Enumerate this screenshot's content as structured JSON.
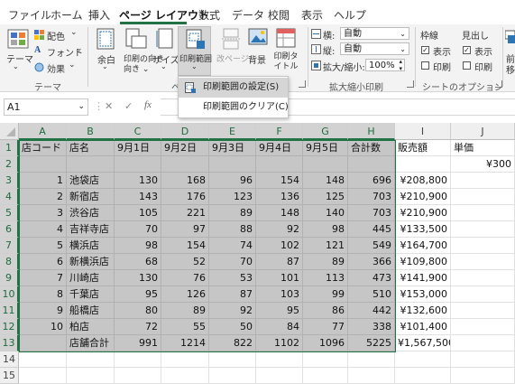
{
  "tabs": [
    "ファイル",
    "ホーム",
    "挿入",
    "ページ レイアウト",
    "数式",
    "データ",
    "校閲",
    "表示",
    "ヘルプ"
  ],
  "ribbon": {
    "theme": {
      "theme_label": "テーマ",
      "colors_label": "配色",
      "fonts_label": "フォント",
      "effects_label": "効果",
      "group_label": "テーマ"
    },
    "page_setup": {
      "margins_label": "余白",
      "orientation_label": "印刷の向き",
      "size_label": "サイズ",
      "print_area_label": "印刷範囲",
      "breaks_label": "改ページ",
      "background_label": "背景",
      "print_titles_label": "印刷タイトル",
      "group_label_partial": "ペ"
    },
    "scale": {
      "width_label": "横:",
      "width_value": "自動",
      "height_label": "縦:",
      "height_value": "自動",
      "scale_label": "拡大/縮小:",
      "scale_value": "100%",
      "group_label": "拡大縮小印刷"
    },
    "sheet_options": {
      "gridlines_label": "枠線",
      "headings_label": "見出し",
      "view_label": "表示",
      "print_label": "印刷",
      "group_label": "シートのオプション"
    },
    "arrange_partial": {
      "line1": "前",
      "line2": "移"
    }
  },
  "menu": {
    "set_print_area": "印刷範囲の設定(S)",
    "clear_print_area": "印刷範囲のクリア(C)"
  },
  "formula_bar": {
    "name_box": "A1",
    "cancel_glyph": "✕",
    "enter_glyph": "✓",
    "fx_label": "fx"
  },
  "sheet": {
    "columns": [
      "A",
      "B",
      "C",
      "D",
      "E",
      "F",
      "G",
      "H",
      "I",
      "J"
    ],
    "row_numbers": [
      "1",
      "2",
      "3",
      "4",
      "5",
      "6",
      "7",
      "8",
      "9",
      "10",
      "11",
      "12",
      "13",
      "14",
      "15"
    ],
    "rows": [
      [
        "店コード",
        "店名",
        "9月1日",
        "9月2日",
        "9月3日",
        "9月4日",
        "9月5日",
        "合計数",
        "販売額",
        "単価"
      ],
      [
        "",
        "",
        "",
        "",
        "",
        "",
        "",
        "",
        "",
        "¥300"
      ],
      [
        "1",
        "池袋店",
        "130",
        "168",
        "96",
        "154",
        "148",
        "696",
        "¥208,800",
        ""
      ],
      [
        "2",
        "新宿店",
        "143",
        "176",
        "123",
        "136",
        "125",
        "703",
        "¥210,900",
        ""
      ],
      [
        "3",
        "渋谷店",
        "105",
        "221",
        "89",
        "148",
        "140",
        "703",
        "¥210,900",
        ""
      ],
      [
        "4",
        "吉祥寺店",
        "70",
        "97",
        "88",
        "92",
        "98",
        "445",
        "¥133,500",
        ""
      ],
      [
        "5",
        "横浜店",
        "98",
        "154",
        "74",
        "102",
        "121",
        "549",
        "¥164,700",
        ""
      ],
      [
        "6",
        "新横浜店",
        "68",
        "52",
        "70",
        "87",
        "89",
        "366",
        "¥109,800",
        ""
      ],
      [
        "7",
        "川崎店",
        "130",
        "76",
        "53",
        "101",
        "113",
        "473",
        "¥141,900",
        ""
      ],
      [
        "8",
        "千葉店",
        "95",
        "126",
        "87",
        "103",
        "99",
        "510",
        "¥153,000",
        ""
      ],
      [
        "9",
        "船橋店",
        "80",
        "89",
        "92",
        "95",
        "86",
        "442",
        "¥132,600",
        ""
      ],
      [
        "10",
        "柏店",
        "72",
        "55",
        "50",
        "84",
        "77",
        "338",
        "¥101,400",
        ""
      ],
      [
        "",
        "店舗合計",
        "991",
        "1214",
        "822",
        "1102",
        "1096",
        "5225",
        "¥1,567,500",
        ""
      ],
      [
        "",
        "",
        "",
        "",
        "",
        "",
        "",
        "",
        "",
        ""
      ],
      [
        "",
        "",
        "",
        "",
        "",
        "",
        "",
        "",
        "",
        ""
      ]
    ]
  }
}
